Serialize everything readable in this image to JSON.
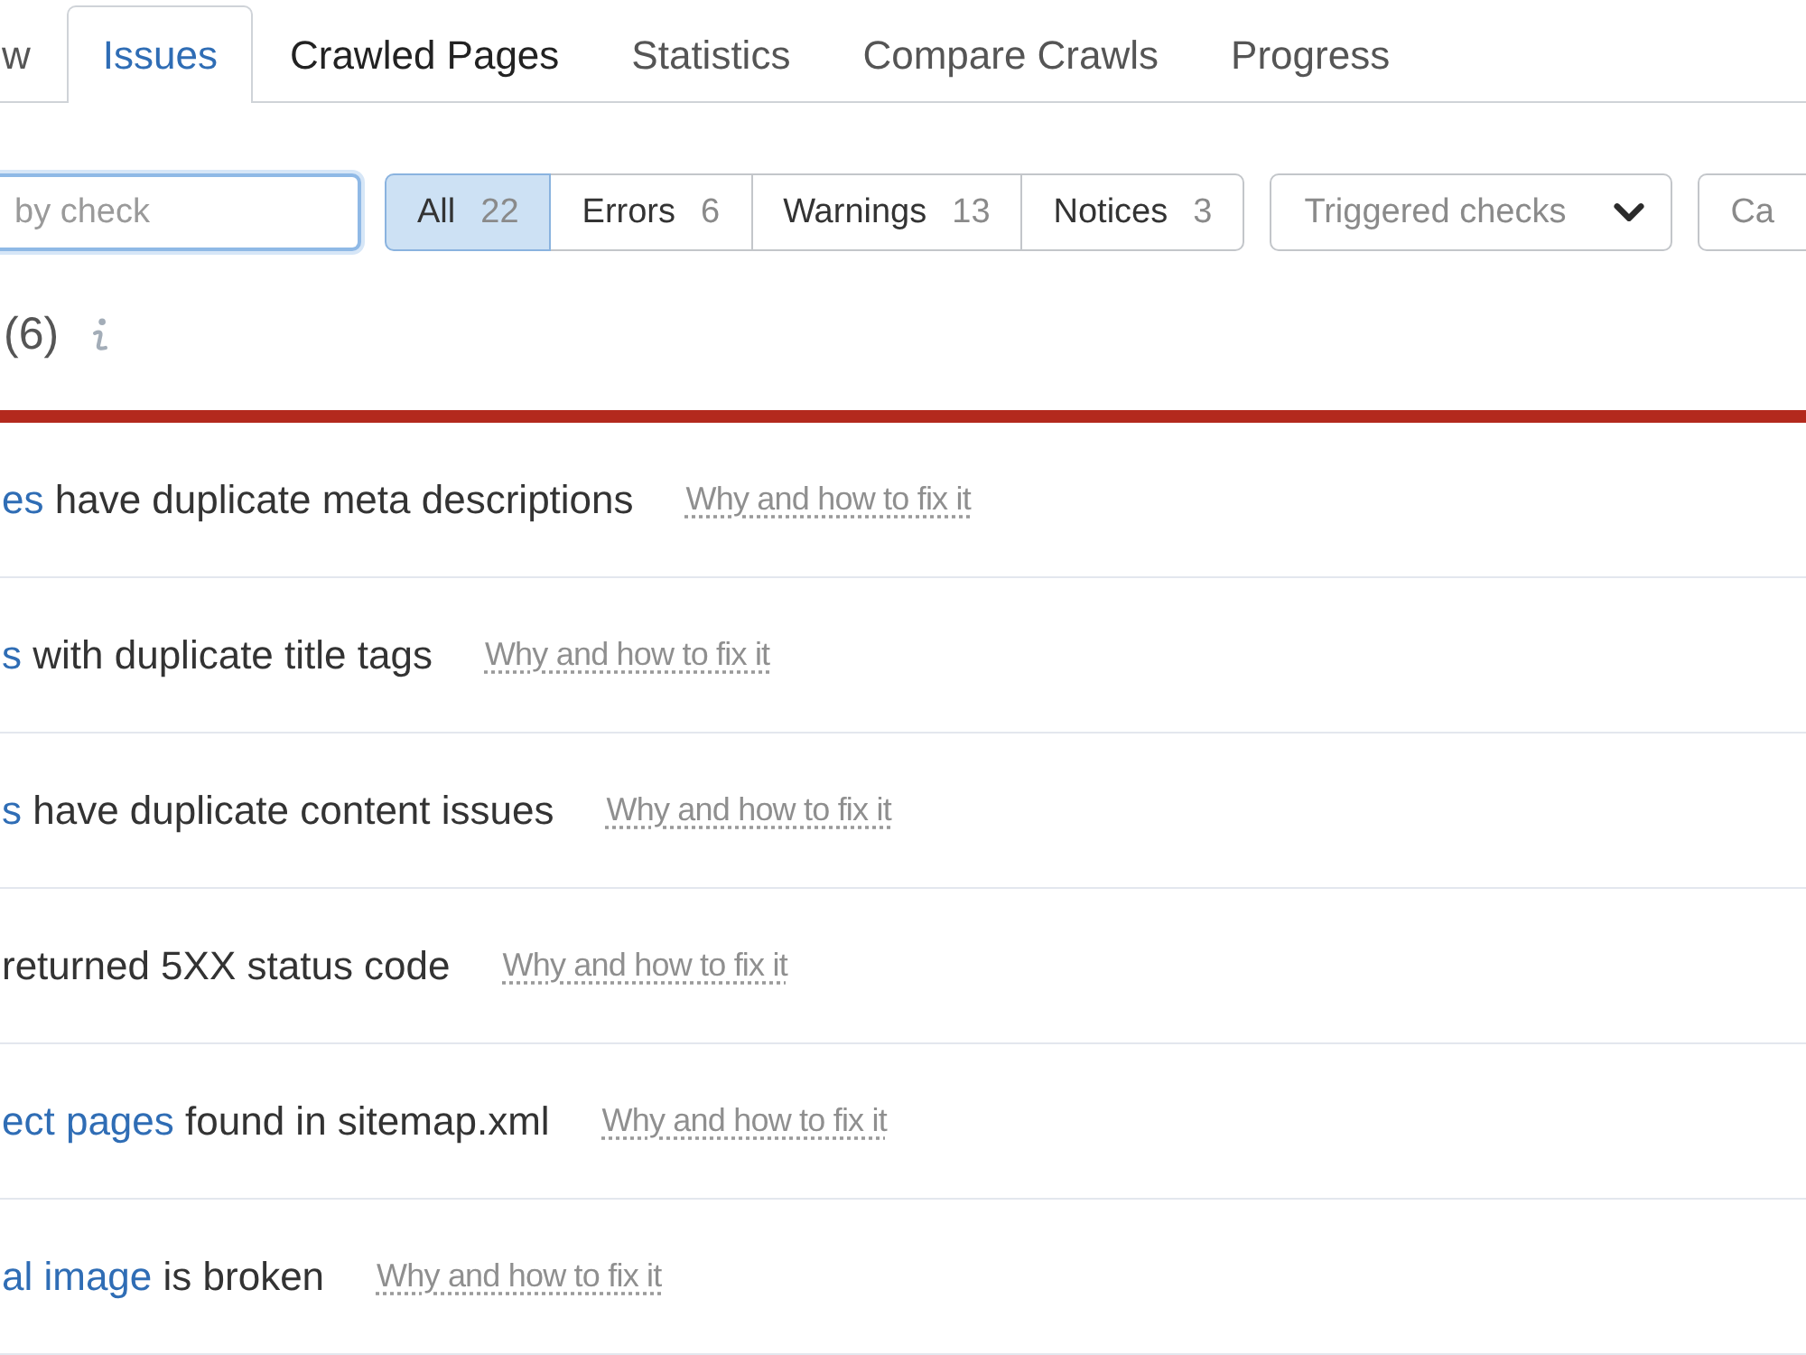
{
  "tabs": [
    {
      "label": "w",
      "selected": false,
      "hovered": false
    },
    {
      "label": "Issues",
      "selected": true,
      "hovered": false
    },
    {
      "label": "Crawled Pages",
      "selected": false,
      "hovered": true
    },
    {
      "label": "Statistics",
      "selected": false,
      "hovered": false
    },
    {
      "label": "Compare Crawls",
      "selected": false,
      "hovered": false
    },
    {
      "label": "Progress",
      "selected": false,
      "hovered": false
    }
  ],
  "filters": {
    "search": {
      "placeholder": "by check",
      "focused": true
    },
    "severity": [
      {
        "label": "All",
        "count": "22",
        "selected": true
      },
      {
        "label": "Errors",
        "count": "6",
        "selected": false
      },
      {
        "label": "Warnings",
        "count": "13",
        "selected": false
      },
      {
        "label": "Notices",
        "count": "3",
        "selected": false
      }
    ],
    "dropdown": {
      "label": "Triggered checks"
    },
    "category": {
      "label": "Ca"
    }
  },
  "heading": {
    "count": "(6)"
  },
  "issues": [
    {
      "link": "es",
      "text": "have duplicate meta descriptions",
      "help": "Why and how to fix it"
    },
    {
      "link": "s",
      "text": "with duplicate title tags",
      "help": "Why and how to fix it"
    },
    {
      "link": "s",
      "text": "have duplicate content issues",
      "help": "Why and how to fix it"
    },
    {
      "text": "returned 5XX status code",
      "help": "Why and how to fix it"
    },
    {
      "link": "ect pages",
      "text": "found in sitemap.xml",
      "help": "Why and how to fix it"
    },
    {
      "link": "al image",
      "text": "is broken",
      "help": "Why and how to fix it"
    }
  ]
}
